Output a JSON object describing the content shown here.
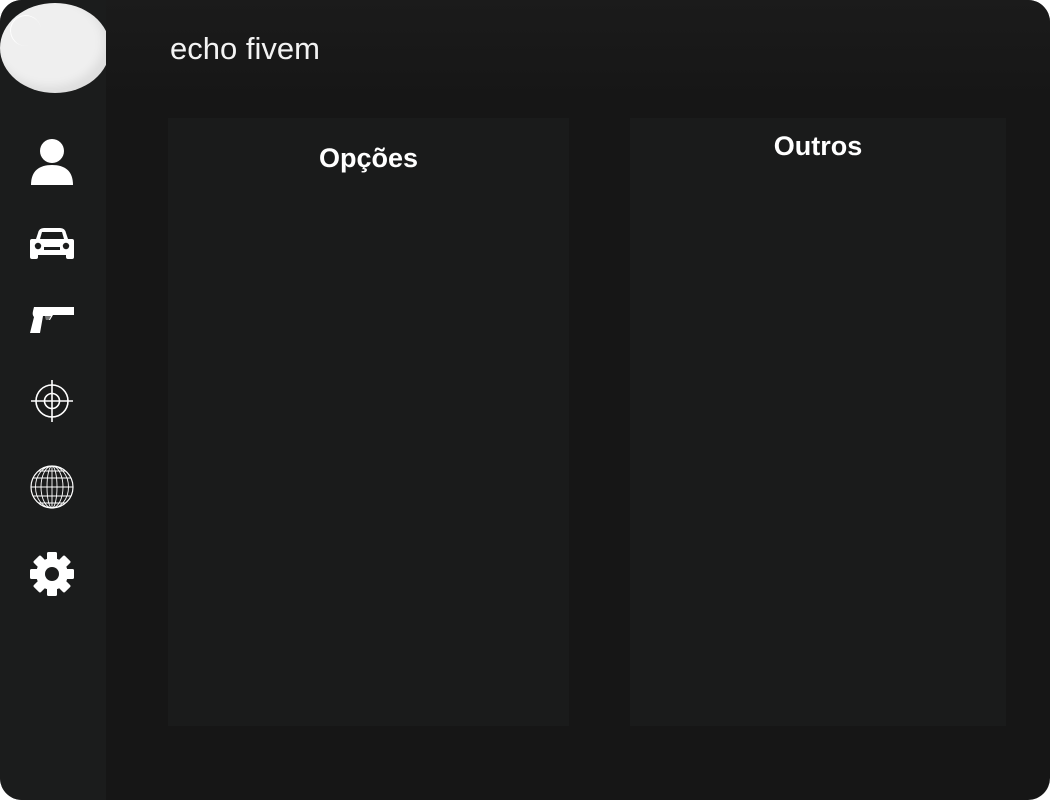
{
  "app": {
    "title": "echo fivem"
  },
  "sidebar": {
    "logo": "logo-circle",
    "items": [
      {
        "id": "player",
        "icon": "user-icon"
      },
      {
        "id": "vehicle",
        "icon": "car-icon"
      },
      {
        "id": "weapon",
        "icon": "pistol-icon"
      },
      {
        "id": "aim",
        "icon": "crosshair-icon"
      },
      {
        "id": "world",
        "icon": "globe-icon"
      },
      {
        "id": "settings",
        "icon": "gear-icon"
      }
    ]
  },
  "panels": {
    "left_title": "Opções",
    "right_title": "Outros"
  },
  "colors": {
    "background": "#161616",
    "sidebar": "#1b1c1c",
    "panel": "#1a1b1b",
    "text": "#ffffff",
    "logo": "#efefef"
  }
}
